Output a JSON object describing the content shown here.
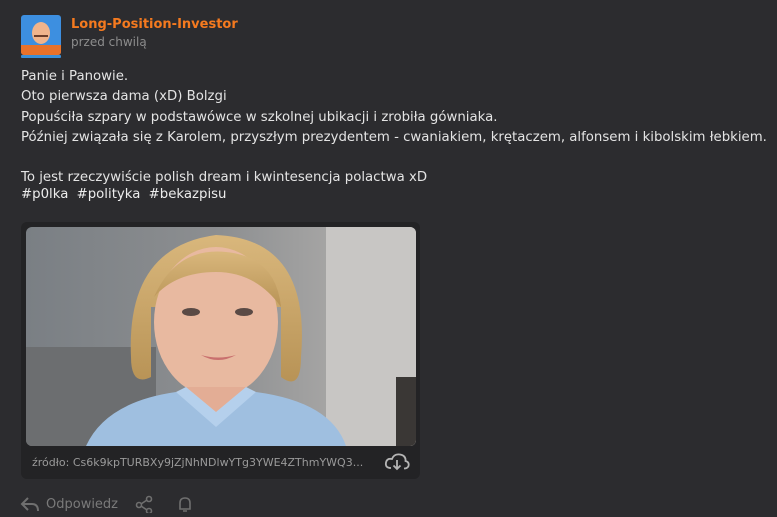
{
  "post": {
    "author": "Long-Position-Investor",
    "time": "przed chwilą",
    "lines": [
      "Panie i Panowie.",
      "Oto pierwsza dama (xD) Bolzgi",
      "Popuściła szpary w podstawówce w szkolnej ubikacji i zrobiła gówniaka.",
      "Później związała się z Karolem, przyszłym prezydentem - cwaniakiem, krętaczem, alfonsem i kibolskim łebkiem.",
      "",
      "To jest rzeczywiście polish dream i kwintesencja polactwa xD"
    ],
    "tags": [
      "#p0lka",
      "#polityka",
      "#bekazpisu"
    ],
    "embed": {
      "source": "źródło: Cs6k9kpTURBXy9jZjNhNDlwYTg3YWE4ZThmYWQ3..."
    },
    "actions": {
      "reply_label": "Odpowiedz"
    }
  },
  "colors": {
    "background": "#2c2c2f",
    "author": "#f57a1f",
    "embed_bg": "#232325"
  }
}
